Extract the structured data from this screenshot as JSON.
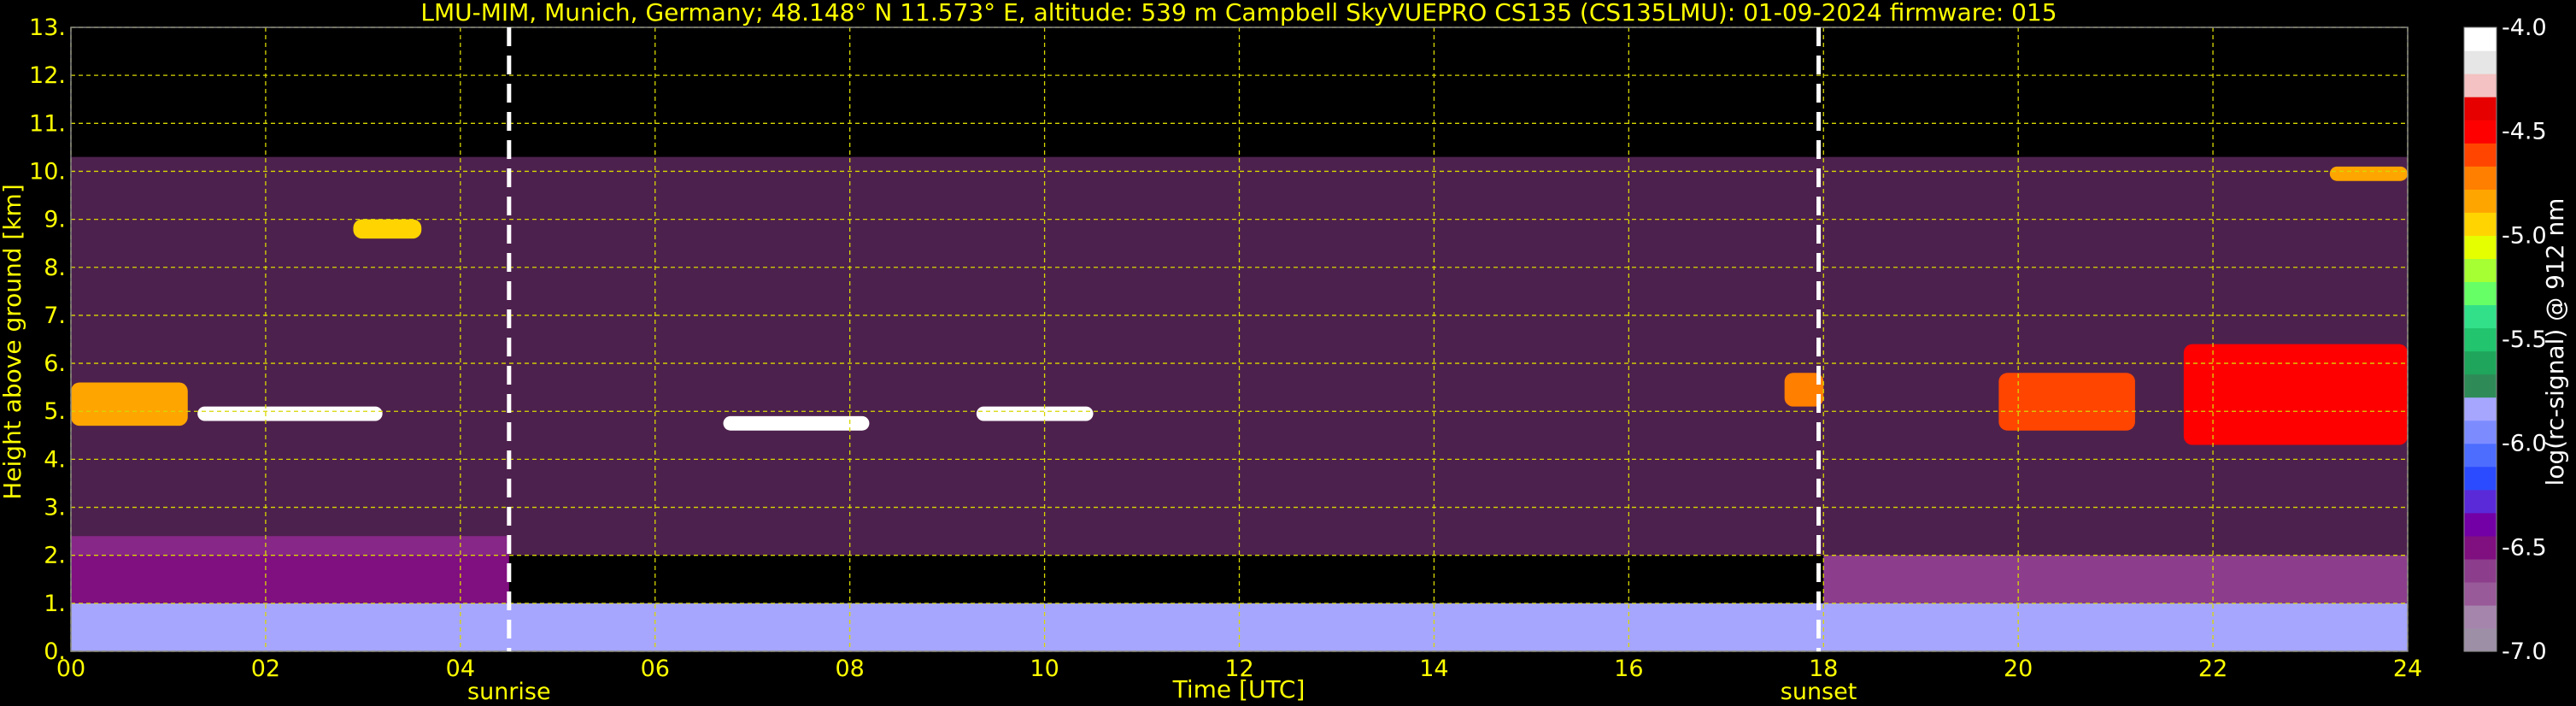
{
  "chart_data": {
    "type": "heatmap",
    "title": "LMU-MIM, Munich, Germany; 48.148° N 11.573° E, altitude: 539 m    Campbell SkyVUEPRO CS135 (CS135LMU): 01-09-2024    firmware: 015",
    "xlabel": "Time [UTC]",
    "ylabel": "Height above ground [km]",
    "xlim": [
      0,
      24
    ],
    "ylim": [
      0,
      13
    ],
    "x_ticks": [
      "00",
      "02",
      "04",
      "06",
      "08",
      "10",
      "12",
      "14",
      "16",
      "18",
      "20",
      "22",
      "24"
    ],
    "y_ticks": [
      "0.",
      "1.",
      "2.",
      "3.",
      "4.",
      "5.",
      "6.",
      "7.",
      "8.",
      "9.",
      "10.",
      "11.",
      "12.",
      "13."
    ],
    "grid": true,
    "events": [
      {
        "label": "sunrise",
        "time": 4.5
      },
      {
        "label": "sunset",
        "time": 17.95
      }
    ],
    "colorbar": {
      "label": "log(rc-signal) @ 912 nm",
      "range": [
        -7.0,
        -4.0
      ],
      "ticks": [
        "-4.0",
        "-4.5",
        "-5.0",
        "-5.5",
        "-6.0",
        "-6.5",
        "-7.0"
      ],
      "colors": [
        "#9c8fa6",
        "#a685ad",
        "#995a99",
        "#8c3d8c",
        "#800f80",
        "#7300a6",
        "#5a2ad9",
        "#2a4bff",
        "#4d6dff",
        "#7c8cff",
        "#a6a6ff",
        "#2e8b57",
        "#1fa65c",
        "#22c46e",
        "#33e08a",
        "#66ff66",
        "#a6ff33",
        "#e6ff00",
        "#ffd400",
        "#ffa500",
        "#ff7f00",
        "#ff4500",
        "#ff0000",
        "#e60000",
        "#f4c2c2",
        "#e6e6e6",
        "#ffffff"
      ]
    },
    "features": [
      {
        "name": "boundary-layer",
        "start": 0,
        "end": 24,
        "base_km": 0.0,
        "top_km": 1.0,
        "level": -5.8
      },
      {
        "name": "residual-layer-night",
        "start": 0,
        "end": 4.5,
        "base_km": 1.0,
        "top_km": 2.4,
        "level": -6.5
      },
      {
        "name": "residual-layer-evening",
        "start": 18.0,
        "end": 24,
        "base_km": 1.0,
        "top_km": 2.0,
        "level": -6.6
      },
      {
        "name": "noise-region",
        "start": 0,
        "end": 24,
        "base_km": 2.0,
        "top_km": 10.3,
        "level": -6.6
      },
      {
        "name": "cloud-early",
        "start": 0,
        "end": 1.2,
        "base_km": 4.7,
        "top_km": 5.6,
        "level": -4.8
      },
      {
        "name": "cloud-streak-1",
        "start": 1.3,
        "end": 3.2,
        "base_km": 4.8,
        "top_km": 5.1,
        "level": -4.1
      },
      {
        "name": "cloud-streak-2",
        "start": 6.7,
        "end": 8.2,
        "base_km": 4.6,
        "top_km": 4.9,
        "level": -4.1
      },
      {
        "name": "cloud-streak-3",
        "start": 9.3,
        "end": 10.5,
        "base_km": 4.8,
        "top_km": 5.1,
        "level": -4.1
      },
      {
        "name": "cloud-cirrus-early",
        "start": 2.9,
        "end": 3.6,
        "base_km": 8.6,
        "top_km": 9.0,
        "level": -5.0
      },
      {
        "name": "cloud-dusk",
        "start": 17.6,
        "end": 18.0,
        "base_km": 5.1,
        "top_km": 5.8,
        "level": -4.7
      },
      {
        "name": "cloud-evening-1",
        "start": 19.8,
        "end": 21.2,
        "base_km": 4.6,
        "top_km": 5.8,
        "level": -4.6
      },
      {
        "name": "cloud-evening-2",
        "start": 21.7,
        "end": 24.0,
        "base_km": 4.3,
        "top_km": 6.4,
        "level": -4.5
      },
      {
        "name": "cloud-cirrus-late",
        "start": 23.2,
        "end": 24.0,
        "base_km": 9.8,
        "top_km": 10.1,
        "level": -4.8
      }
    ]
  }
}
